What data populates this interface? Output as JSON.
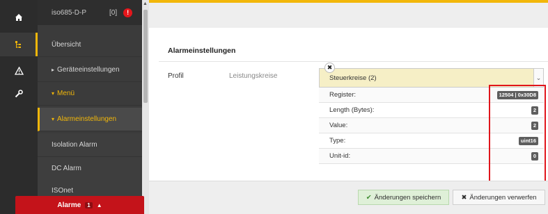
{
  "colors": {
    "accent": "#f2b70a",
    "alarm": "#c4131a",
    "highlight": "#e0151b"
  },
  "rail": {
    "icons": [
      "home-icon",
      "tree-icon",
      "warning-icon",
      "wrench-icon"
    ]
  },
  "nav": {
    "device": "iso685-D-P",
    "count": "[0]",
    "alert": "!",
    "items": [
      {
        "label": "Übersicht"
      },
      {
        "label": "Geräteeinstellungen"
      },
      {
        "label": "Menü"
      },
      {
        "label": "Alarmeinstellungen"
      },
      {
        "label": "Isolation Alarm"
      },
      {
        "label": "DC Alarm"
      },
      {
        "label": "ISOnet"
      }
    ]
  },
  "alarm_bar": {
    "label": "Alarme",
    "count": "1",
    "arrow": "▲"
  },
  "main": {
    "section_title": "Alarmeinstellungen",
    "profil_label": "Profil",
    "profil_value_label": "Leistungskreise",
    "select_value": "Steuerkreise (2)",
    "rows": [
      {
        "label": "Register:",
        "value": "12504 | 0x30D8"
      },
      {
        "label": "Length (Bytes):",
        "value": "2"
      },
      {
        "label": "Value:",
        "value": "2"
      },
      {
        "label": "Type:",
        "value": "uint16"
      },
      {
        "label": "Unit-id:",
        "value": "0"
      }
    ],
    "save_label": "Änderungen speichern",
    "discard_label": "Änderungen verwerfen"
  }
}
